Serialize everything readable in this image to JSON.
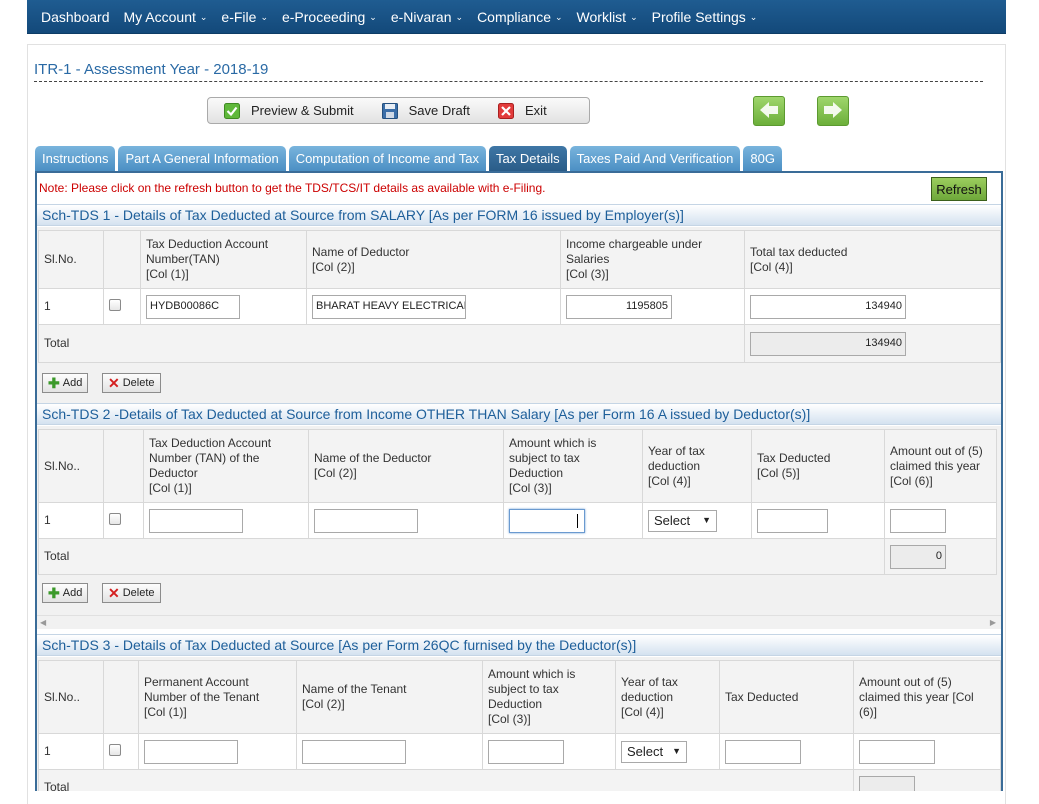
{
  "nav": {
    "items": [
      {
        "label": "Dashboard",
        "caret": false
      },
      {
        "label": "My Account",
        "caret": true
      },
      {
        "label": "e-File",
        "caret": true
      },
      {
        "label": "e-Proceeding",
        "caret": true
      },
      {
        "label": "e-Nivaran",
        "caret": true
      },
      {
        "label": "Compliance",
        "caret": true
      },
      {
        "label": "Worklist",
        "caret": true
      },
      {
        "label": "Profile Settings",
        "caret": true
      }
    ]
  },
  "page_title": "ITR-1 - Assessment Year - 2018-19",
  "toolbar": {
    "preview_label": "Preview & Submit",
    "save_label": "Save Draft",
    "exit_label": "Exit"
  },
  "tabs": [
    "Instructions",
    "Part A General Information",
    "Computation of Income and Tax",
    "Tax Details",
    "Taxes Paid And Verification",
    "80G"
  ],
  "active_tab": "Tax Details",
  "note": "Note: Please click on the refresh button to get the TDS/TCS/IT details as available with e-Filing.",
  "refresh_label": "Refresh",
  "tds1": {
    "title": "Sch-TDS 1 - Details of Tax Deducted at Source from SALARY [As per FORM 16 issued by Employer(s)]",
    "headers": [
      "Sl.No.",
      "",
      "Tax Deduction Account Number(TAN)\n[Col (1)]",
      "Name of Deductor\n[Col (2)]",
      "Income chargeable under Salaries\n[Col (3)]",
      "Total tax deducted\n[Col (4)]"
    ],
    "row": {
      "slno": "1",
      "tan": "HYDB00086C",
      "name": "BHARAT HEAVY ELECTRICAL",
      "income": "1195805",
      "tax": "134940"
    },
    "total_label": "Total",
    "total_value": "134940"
  },
  "tds2": {
    "title": "Sch-TDS 2 -Details of Tax Deducted at Source from Income OTHER THAN Salary [As per Form 16 A issued by Deductor(s)]",
    "headers": [
      "Sl.No..",
      "",
      "Tax Deduction Account Number (TAN) of the Deductor\n[Col (1)]",
      "Name of the Deductor\n[Col (2)]",
      "Amount which is subject to tax Deduction\n[Col (3)]",
      "Year of tax deduction\n[Col (4)]",
      "Tax Deducted\n[Col (5)]",
      "Amount out of (5) claimed this year\n[Col (6)]"
    ],
    "row": {
      "slno": "1",
      "tan": "",
      "name": "",
      "amount": "",
      "year": "Select",
      "tax": "",
      "claimed": ""
    },
    "total_label": "Total",
    "total_value": "0"
  },
  "tds3": {
    "title": "Sch-TDS 3 - Details of Tax Deducted at Source [As per Form 26QC furnised by the Deductor(s)]",
    "headers": [
      "Sl.No..",
      "",
      "Permanent Account Number of the Tenant\n[Col (1)]",
      "Name of the Tenant\n[Col (2)]",
      "Amount which is subject to tax Deduction\n[Col (3)]",
      "Year of tax deduction\n[Col (4)]",
      "Tax Deducted",
      "Amount out of (5) claimed this year [Col (6)]"
    ],
    "row": {
      "slno": "1",
      "pan": "",
      "name": "",
      "amount": "",
      "year": "Select",
      "tax": "",
      "claimed": ""
    },
    "total_label": "Total"
  },
  "buttons": {
    "add": "Add",
    "delete": "Delete"
  },
  "colors": {
    "nav_bg": "#1a5488",
    "tab_bg": "#5a9ccf",
    "tab_active": "#2f6694",
    "note": "#cc0000",
    "refresh": "#7fb747",
    "section_title": "#1e5f9a"
  }
}
